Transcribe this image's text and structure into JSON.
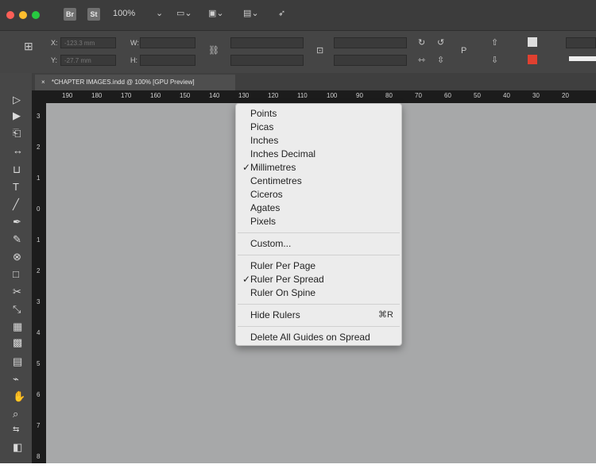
{
  "titlebar": {
    "br_label": "Br",
    "st_label": "St",
    "zoom": "100%",
    "traffic_colors": [
      "#fc5f57",
      "#fdbd2e",
      "#27c840"
    ]
  },
  "control": {
    "x_label": "X:",
    "x_value": "-123.3 mm",
    "y_label": "Y:",
    "y_value": "-27.7 mm",
    "w_label": "W:",
    "h_label": "H:"
  },
  "tab": {
    "close": "×",
    "title": "*CHAPTER IMAGES.indd @ 100% [GPU Preview]"
  },
  "ruler": {
    "h_labels": [
      "190",
      "180",
      "170",
      "160",
      "150",
      "140",
      "130",
      "120",
      "110",
      "100",
      "90",
      "80",
      "70",
      "60",
      "50",
      "40",
      "30",
      "20"
    ],
    "v_labels": [
      "3",
      "2",
      "1",
      "0",
      "1",
      "2",
      "3",
      "4",
      "5",
      "6",
      "7",
      "8"
    ]
  },
  "menu": {
    "units": [
      {
        "label": "Points",
        "checked": false
      },
      {
        "label": "Picas",
        "checked": false
      },
      {
        "label": "Inches",
        "checked": false
      },
      {
        "label": "Inches Decimal",
        "checked": false
      },
      {
        "label": "Millimetres",
        "checked": true
      },
      {
        "label": "Centimetres",
        "checked": false
      },
      {
        "label": "Ciceros",
        "checked": false
      },
      {
        "label": "Agates",
        "checked": false
      },
      {
        "label": "Pixels",
        "checked": false
      }
    ],
    "custom": "Custom...",
    "ruler_modes": [
      {
        "label": "Ruler Per Page",
        "checked": false
      },
      {
        "label": "Ruler Per Spread",
        "checked": true
      },
      {
        "label": "Ruler On Spine",
        "checked": false
      }
    ],
    "hide_rulers": "Hide Rulers",
    "hide_rulers_shortcut": "⌘R",
    "delete_guides": "Delete All Guides on Spread",
    "check_glyph": "✓"
  }
}
